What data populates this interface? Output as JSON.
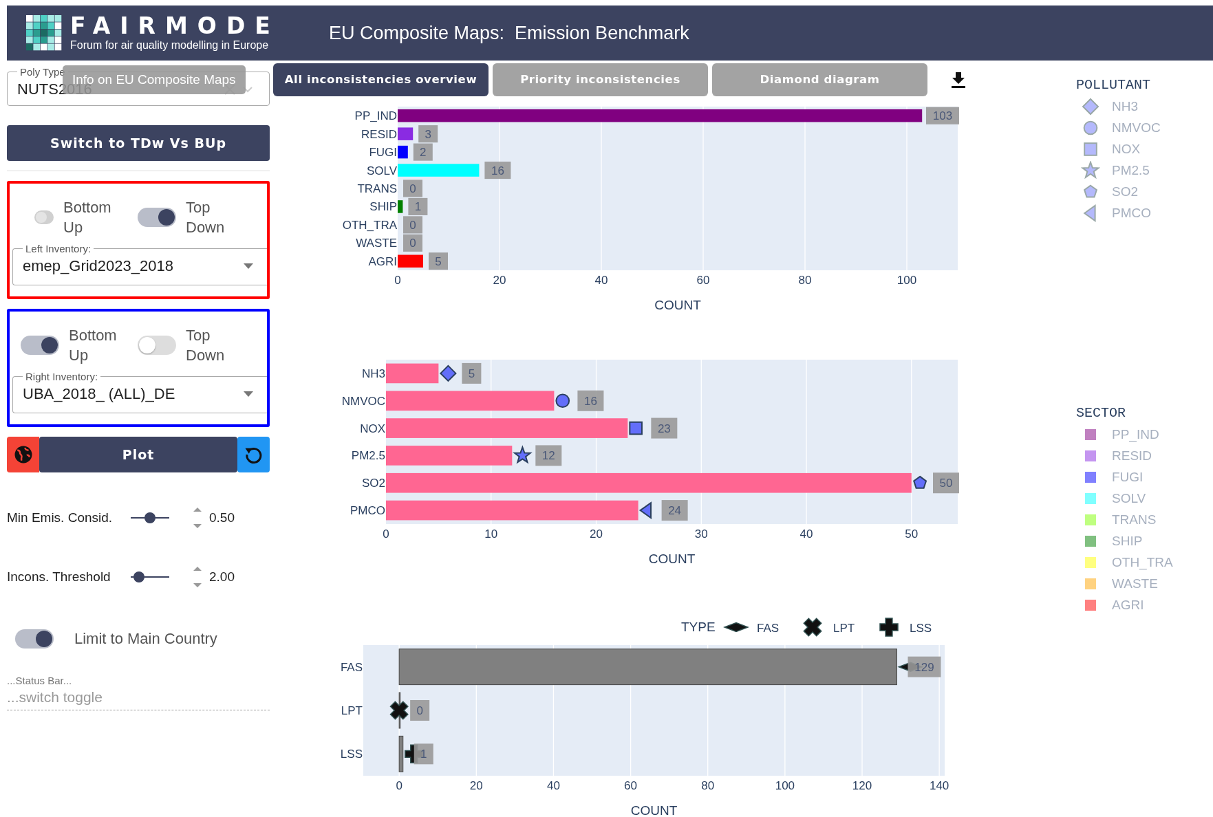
{
  "header": {
    "logo_name": "FAIRMODE",
    "logo_subtitle": "Forum for air quality modelling in Europe",
    "title": "EU Composite Maps:  Emission Benchmark"
  },
  "poly_type": {
    "label": "Poly Type",
    "value": "NUTS2016"
  },
  "tooltip": "Info on EU Composite Maps",
  "switch_button": "Switch to TDw Vs BUp",
  "inventories": [
    {
      "color": "#ff0000",
      "label": "Left Inventory:",
      "value": "emep_Grid2023_2018",
      "toggles": [
        {
          "label": "Bottom Up",
          "on": false,
          "disabled": true
        },
        {
          "label": "Top Down",
          "on": true,
          "disabled": false
        }
      ]
    },
    {
      "color": "#0000ff",
      "label": "Right Inventory:",
      "value": "UBA_2018_ (ALL)_DE",
      "toggles": [
        {
          "label": "Bottom Up",
          "on": true,
          "disabled": false
        },
        {
          "label": "Top Down",
          "on": false,
          "disabled": false
        }
      ]
    }
  ],
  "plot_button": "Plot",
  "sliders": [
    {
      "label": "Min Emis. Consid.",
      "level": 0.5,
      "value": "0.50"
    },
    {
      "label": "Incons. Threshold",
      "level": 0.1,
      "value": "2.00"
    }
  ],
  "limit_toggle": {
    "label": "Limit to Main Country",
    "on": true
  },
  "status_bar": {
    "label": "...Status Bar...",
    "placeholder": "...switch toggle"
  },
  "tabs": [
    {
      "label": "All inconsistencies overview",
      "selected": true
    },
    {
      "label": "Priority inconsistencies",
      "selected": false
    },
    {
      "label": "Diamond diagram",
      "selected": false
    }
  ],
  "charts": [
    {
      "chart_data": {
        "type": "bar",
        "orientation": "h",
        "xlabel": "COUNT",
        "xlim": [
          0,
          110
        ],
        "xticks": [
          0,
          20,
          40,
          60,
          80,
          100
        ],
        "grid": true,
        "data_labels": true,
        "series": [
          {
            "name": "PP_IND",
            "color": "#800080",
            "values": [
              103,
              null,
              null,
              null,
              null,
              null,
              null,
              null,
              null
            ]
          },
          {
            "name": "RESID",
            "color": "#8a2be2",
            "values": [
              null,
              3,
              null,
              null,
              null,
              null,
              null,
              null,
              null
            ]
          },
          {
            "name": "FUGI",
            "color": "#0000ff",
            "values": [
              null,
              null,
              2,
              null,
              null,
              null,
              null,
              null,
              null
            ]
          },
          {
            "name": "SOLV",
            "color": "#00ffff",
            "values": [
              null,
              null,
              null,
              16,
              null,
              null,
              null,
              null,
              null
            ]
          },
          {
            "name": "TRANS",
            "values": [
              null,
              null,
              null,
              null,
              0,
              null,
              null,
              null,
              null
            ]
          },
          {
            "name": "SHIP",
            "color": "#008000",
            "values": [
              null,
              null,
              null,
              null,
              null,
              1,
              null,
              null,
              null
            ]
          },
          {
            "name": "OTH_TRA",
            "values": [
              null,
              null,
              null,
              null,
              null,
              null,
              0,
              null,
              null
            ]
          },
          {
            "name": "WASTE",
            "values": [
              null,
              null,
              null,
              null,
              null,
              null,
              null,
              0,
              null
            ]
          },
          {
            "name": "AGRI",
            "color": "#ff0000",
            "values": [
              null,
              null,
              null,
              null,
              null,
              null,
              null,
              null,
              5
            ]
          }
        ]
      }
    },
    {
      "chart_data": {
        "type": "bar",
        "orientation": "h",
        "xlabel": "COUNT",
        "categories": [
          "NH3",
          "NMVOC",
          "NOX",
          "PM2.5",
          "SO2",
          "PMCO"
        ],
        "xlim": [
          0,
          54.4
        ],
        "xticks": [
          0,
          10,
          20,
          30,
          40,
          50
        ],
        "grid": true,
        "data_labels": true,
        "values": [
          5,
          16,
          23,
          12,
          50,
          24
        ]
      }
    },
    {
      "legend": {
        "title": "TYPE",
        "items": [
          {
            "label": "FAS",
            "kind": "thin-diamond"
          },
          {
            "label": "LPT",
            "kind": "x"
          },
          {
            "label": "LSS",
            "kind": "cross"
          }
        ]
      },
      "chart_data": {
        "type": "bar",
        "orientation": "h",
        "xlabel": "COUNT",
        "categories": [
          "FAS",
          "LPT",
          "LSS"
        ],
        "xlim": [
          -9.3,
          141.4
        ],
        "xticks": [
          0,
          20,
          40,
          60,
          80,
          100,
          120,
          140
        ],
        "grid": true,
        "data_labels": true,
        "values": [
          129,
          0,
          1
        ]
      }
    }
  ],
  "legends": {
    "pollutant": {
      "title": "POLLUTANT",
      "items": [
        {
          "label": "NH3",
          "kind": "diamond"
        },
        {
          "label": "NMVOC",
          "kind": "circle"
        },
        {
          "label": "NOX",
          "kind": "square"
        },
        {
          "label": "PM2.5",
          "kind": "star"
        },
        {
          "label": "SO2",
          "kind": "pentagon"
        },
        {
          "label": "PMCO",
          "kind": "triangle-left"
        }
      ]
    },
    "sector": {
      "title": "SECTOR",
      "items": [
        {
          "label": "PP_IND",
          "color": "#c080c0"
        },
        {
          "label": "RESID",
          "color": "#c495f0"
        },
        {
          "label": "FUGI",
          "color": "#8080ff"
        },
        {
          "label": "SOLV",
          "color": "#80ffff"
        },
        {
          "label": "TRANS",
          "color": "#bfff80"
        },
        {
          "label": "SHIP",
          "color": "#80c080"
        },
        {
          "label": "OTH_TRA",
          "color": "#ffff80"
        },
        {
          "label": "WASTE",
          "color": "#ffd280"
        },
        {
          "label": "AGRI",
          "color": "#ff8080"
        }
      ]
    }
  }
}
